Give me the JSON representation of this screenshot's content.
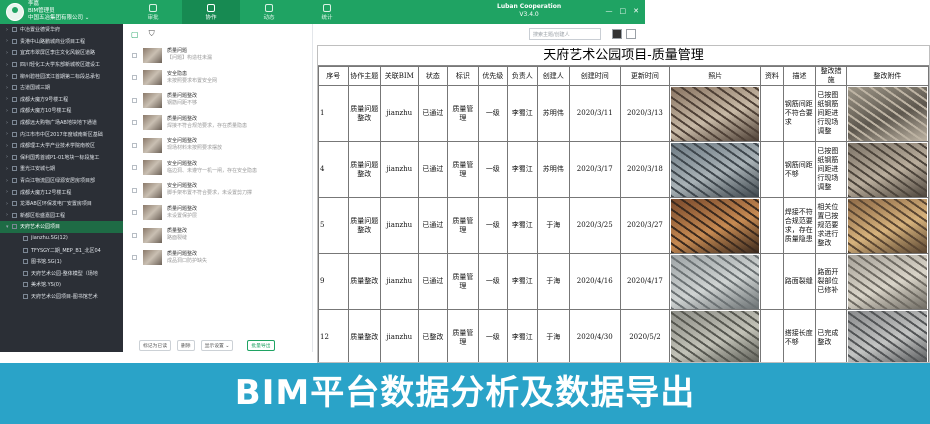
{
  "header": {
    "user_line1": "李嘉",
    "user_line2": "BIM管理员",
    "org": "中国五冶集团有限公司 ⌄",
    "nav": [
      {
        "label": "审批",
        "active": false
      },
      {
        "label": "协作",
        "active": true
      },
      {
        "label": "动态",
        "active": false
      },
      {
        "label": "统计",
        "active": false
      }
    ],
    "brand": "Luban Cooperation",
    "version": "V3.4.0",
    "controls": [
      "—",
      "□",
      "✕"
    ]
  },
  "sidebar": {
    "items": [
      {
        "label": "中冶置业德贤华府",
        "type": "proj"
      },
      {
        "label": "贵港中山路鹏城商业项目工程",
        "type": "proj"
      },
      {
        "label": "宜宾市翠屏区李庄文化风貌区道路",
        "type": "proj"
      },
      {
        "label": "四川轻化工大学东部新城校区建设工",
        "type": "proj"
      },
      {
        "label": "柳州碧桂园滨江首期第二标段总承包",
        "type": "proj"
      },
      {
        "label": "古道国城三期",
        "type": "proj"
      },
      {
        "label": "成都大魔方9号楼工程",
        "type": "proj"
      },
      {
        "label": "成都大魔方10号楼工程",
        "type": "proj"
      },
      {
        "label": "成都远大购物广场AB地块地下通道",
        "type": "proj"
      },
      {
        "label": "内江市市中区2017年度城南新区基础",
        "type": "proj"
      },
      {
        "label": "成都理工大学产业技术学院南校区",
        "type": "proj"
      },
      {
        "label": "保利国秀首城P1-01地块一标段施工",
        "type": "proj"
      },
      {
        "label": "重光江安城七期",
        "type": "proj"
      },
      {
        "label": "青白江物流园区绿源安居房项目部",
        "type": "proj"
      },
      {
        "label": "成都大魔方12号楼工程",
        "type": "proj"
      },
      {
        "label": "龙潭AB区环保发电厂安置房项目",
        "type": "proj"
      },
      {
        "label": "新都区松盛嘉园工程",
        "type": "proj"
      },
      {
        "label": "天府艺术公园项目",
        "type": "active"
      },
      {
        "label": "jianzhu.SG(12)",
        "type": "child"
      },
      {
        "label": "TFYSGY二期_MEP_B1_北区04",
        "type": "child"
      },
      {
        "label": "图书馆.SG(1)",
        "type": "child"
      },
      {
        "label": "天府艺术公园-整体模型（场地",
        "type": "child"
      },
      {
        "label": "美术馆.YS(0)",
        "type": "child"
      },
      {
        "label": "天府艺术公园项目-图书馆艺术",
        "type": "child"
      }
    ]
  },
  "listpanel": {
    "items": [
      {
        "title": "质量问题",
        "sub": "【问题】构造柱未漏"
      },
      {
        "title": "安全隐患",
        "sub": "未按照要求布置安全网"
      },
      {
        "title": "质量问题整改",
        "sub": "钢筋间距不够"
      },
      {
        "title": "质量问题整改",
        "sub": "焊接不符合规范要求，存在质量隐患"
      },
      {
        "title": "安全问题整改",
        "sub": "现场材料未按照要求摆放"
      },
      {
        "title": "安全问题整改",
        "sub": "临边洞、未遵守一机一闸，存在安全隐患"
      },
      {
        "title": "安全问题整改",
        "sub": "脚手架布置不符合要求，未设置剪刀撑"
      },
      {
        "title": "质量问题整改",
        "sub": "未设置保护层"
      },
      {
        "title": "质量整改",
        "sub": "路面裂缝"
      },
      {
        "title": "质量问题整改",
        "sub": "成品洞口防护缺失"
      }
    ],
    "footer": {
      "mark": "标记为已读",
      "delete": "删除",
      "display": "显示设置 ⌄",
      "export": "批量导出"
    }
  },
  "search": {
    "placeholder": "搜索主题/创建人"
  },
  "sheet": {
    "title": "天府艺术公园项目-质量管理",
    "columns": [
      "序号",
      "协作主题",
      "关联BIM",
      "状态",
      "标识",
      "优先级",
      "负责人",
      "创建人",
      "创建时间",
      "更新时间",
      "照片",
      "资料",
      "描述",
      "整改措施",
      "整改附件"
    ],
    "rows": [
      {
        "no": "1",
        "topic": "质量问题整改",
        "bim": "jianzhu",
        "status": "已通过",
        "tag": "质量管理",
        "priority": "一级",
        "owner": "李蜀江",
        "creator": "苏明伟",
        "created": "2020/3/11",
        "updated": "2020/3/13",
        "desc": "钢筋间距不符合要求",
        "measure": "已按图纸钢筋间距进行现场调整",
        "p": [
          "#8a7563",
          "#c7b9a6",
          "#4e4036"
        ],
        "q": [
          "#9b9486",
          "#5d574e",
          "#bdb3a3"
        ]
      },
      {
        "no": "4",
        "topic": "质量问题整改",
        "bim": "jianzhu",
        "status": "已通过",
        "tag": "质量管理",
        "priority": "一级",
        "owner": "李蜀江",
        "creator": "苏明伟",
        "created": "2020/3/17",
        "updated": "2020/3/18",
        "desc": "钢筋间距不够",
        "measure": "已按图纸钢筋间距进行现场调整",
        "p": [
          "#6e7b84",
          "#a9b2b6",
          "#3f474d"
        ],
        "q": [
          "#7d7468",
          "#b9ad9c",
          "#4c443b"
        ]
      },
      {
        "no": "5",
        "topic": "质量问题整改",
        "bim": "jianzhu",
        "status": "已通过",
        "tag": "质量管理",
        "priority": "一级",
        "owner": "李蜀江",
        "creator": "于海",
        "created": "2020/3/25",
        "updated": "2020/3/27",
        "desc": "焊接不符合规范要求，存在质量隐患",
        "measure": "相关位置已按规范要求进行整改",
        "p": [
          "#7a4a2c",
          "#c68a52",
          "#3b2a1e"
        ],
        "q": [
          "#8f6b48",
          "#d6b27c",
          "#5a4632"
        ]
      },
      {
        "no": "9",
        "topic": "质量整改",
        "bim": "jianzhu",
        "status": "已通过",
        "tag": "质量管理",
        "priority": "一级",
        "owner": "李蜀江",
        "creator": "于海",
        "created": "2020/4/16",
        "updated": "2020/4/17",
        "desc": "路面裂缝",
        "measure": "路面开裂部位已修补",
        "p": [
          "#9ea4a6",
          "#cfd3d2",
          "#6b7173"
        ],
        "q": [
          "#a8a39a",
          "#d9d4c8",
          "#6e6a62"
        ]
      },
      {
        "no": "12",
        "topic": "质量整改",
        "bim": "jianzhu",
        "status": "已整改",
        "tag": "质量管理",
        "priority": "一级",
        "owner": "李蜀江",
        "creator": "于海",
        "created": "2020/4/30",
        "updated": "2020/5/2",
        "desc": "搭接长度不够",
        "measure": "已完成整改",
        "p": [
          "#8e8f88",
          "#c2c2b7",
          "#565750"
        ],
        "q": [
          "#8a8b8d",
          "#c3c4c3",
          "#525456"
        ]
      }
    ]
  },
  "banner": {
    "text": "BIM平台数据分析及数据导出",
    "color": "#2aa3c8"
  }
}
